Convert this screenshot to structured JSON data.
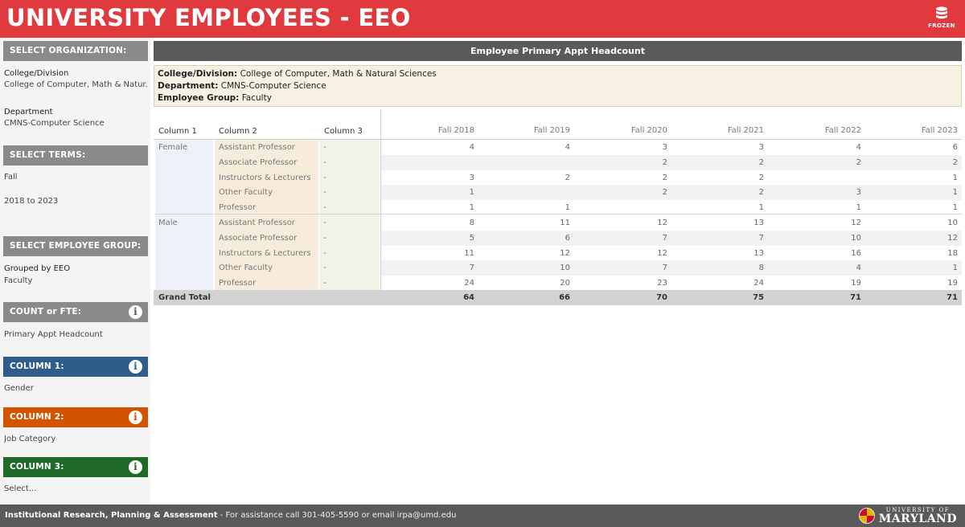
{
  "header": {
    "title": "UNIVERSITY EMPLOYEES - EEO",
    "frozen_label": "FROZEN"
  },
  "sidebar": {
    "select_org": "SELECT ORGANIZATION:",
    "college_label": "College/Division",
    "college_value": "College of Computer, Math & Natur..",
    "department_label": "Department",
    "department_value": "CMNS-Computer Science",
    "select_terms": "SELECT TERMS:",
    "term_value": "Fall",
    "term_range": "2018 to 2023",
    "select_group": "SELECT EMPLOYEE GROUP:",
    "group_line1": "Grouped by EEO",
    "group_line2": "Faculty",
    "count_head": "COUNT or FTE:",
    "count_value": "Primary Appt Headcount",
    "col1_head": "COLUMN 1:",
    "col1_value": "Gender",
    "col2_head": "COLUMN 2:",
    "col2_value": "Job Category",
    "col3_head": "COLUMN 3:",
    "col3_value": "Select..."
  },
  "main": {
    "panel_title": "Employee Primary Appt Headcount",
    "filter": {
      "college_key": "College/Division:",
      "college_val": "College of Computer, Math & Natural Sciences",
      "dept_key": "Department:",
      "dept_val": "CMNS-Computer Science",
      "group_key": "Employee Group:",
      "group_val": "Faculty"
    },
    "columns": [
      "Column 1",
      "Column 2",
      "Column 3"
    ],
    "years": [
      "Fall 2018",
      "Fall 2019",
      "Fall 2020",
      "Fall 2021",
      "Fall 2022",
      "Fall 2023"
    ],
    "groups": [
      {
        "name": "Female",
        "rows": [
          {
            "category": "Assistant Professor",
            "c3": "-",
            "values": [
              "4",
              "4",
              "3",
              "3",
              "4",
              "6"
            ]
          },
          {
            "category": "Associate Professor",
            "c3": "-",
            "values": [
              "",
              "",
              "2",
              "2",
              "2",
              "2"
            ]
          },
          {
            "category": "Instructors & Lecturers",
            "c3": "-",
            "values": [
              "3",
              "2",
              "2",
              "2",
              "",
              "1"
            ]
          },
          {
            "category": "Other Faculty",
            "c3": "-",
            "values": [
              "1",
              "",
              "2",
              "2",
              "3",
              "1"
            ]
          },
          {
            "category": "Professor",
            "c3": "-",
            "values": [
              "1",
              "1",
              "",
              "1",
              "1",
              "1"
            ]
          }
        ]
      },
      {
        "name": "Male",
        "rows": [
          {
            "category": "Assistant Professor",
            "c3": "-",
            "values": [
              "8",
              "11",
              "12",
              "13",
              "12",
              "10"
            ]
          },
          {
            "category": "Associate Professor",
            "c3": "-",
            "values": [
              "5",
              "6",
              "7",
              "7",
              "10",
              "12"
            ]
          },
          {
            "category": "Instructors & Lecturers",
            "c3": "-",
            "values": [
              "11",
              "12",
              "12",
              "13",
              "16",
              "18"
            ]
          },
          {
            "category": "Other Faculty",
            "c3": "-",
            "values": [
              "7",
              "10",
              "7",
              "8",
              "4",
              "1"
            ]
          },
          {
            "category": "Professor",
            "c3": "-",
            "values": [
              "24",
              "20",
              "23",
              "24",
              "19",
              "19"
            ]
          }
        ]
      }
    ],
    "grand_total_label": "Grand Total",
    "grand_totals": [
      "64",
      "66",
      "70",
      "75",
      "71",
      "71"
    ]
  },
  "footer": {
    "org": "Institutional Research, Planning & Assessment",
    "assist": " - For assistance call 301-405-5590 or email irpa@umd.edu",
    "logo_top": "UNIVERSITY OF",
    "logo_bottom": "MARYLAND"
  },
  "colors": {
    "header_red": "#e03a3e",
    "col1_blue": "#2e5d8c",
    "col2_orange": "#d35400",
    "col3_green": "#1e6a28"
  }
}
